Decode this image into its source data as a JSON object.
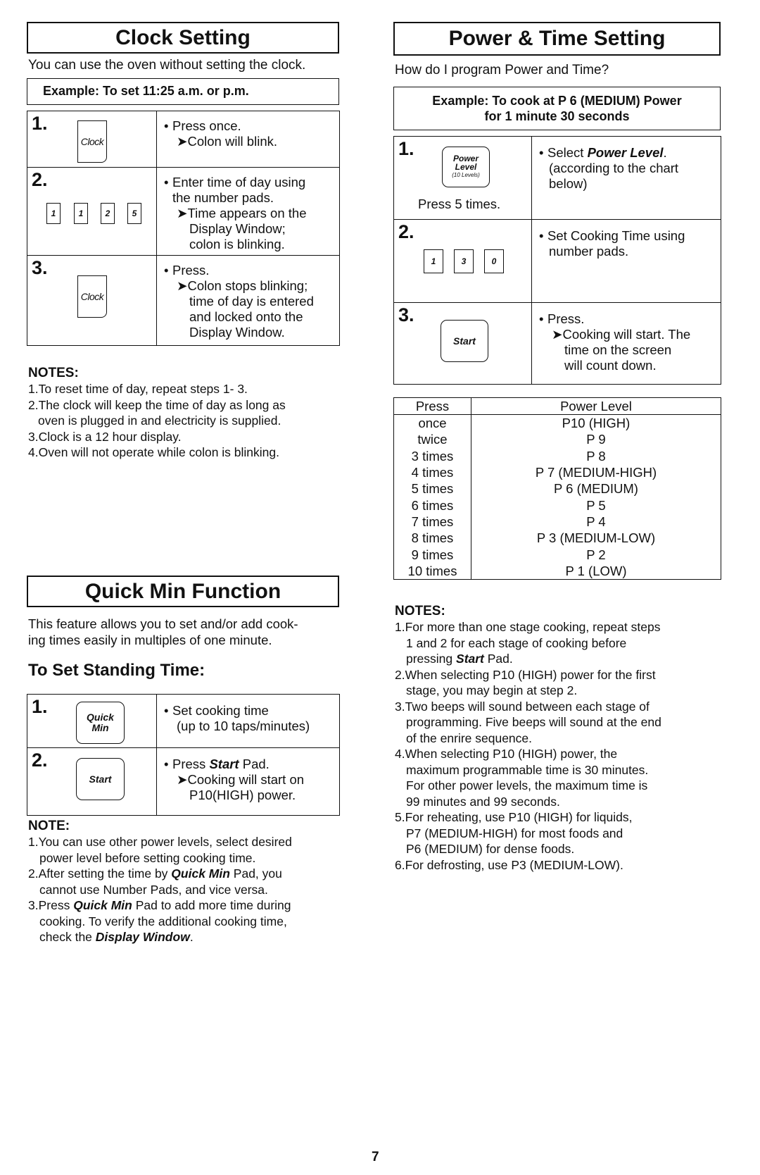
{
  "clock_setting": {
    "title": "Clock Setting",
    "intro": "You can use the oven without setting the clock.",
    "example": "Example:  To set 11:25 a.m. or p.m.",
    "steps": [
      {
        "number": "1.",
        "keys": [
          "Clock"
        ],
        "lines": [
          "Press once.",
          "➤Colon will blink."
        ]
      },
      {
        "number": "2.",
        "keys": [
          "1",
          "1",
          "2",
          "5"
        ],
        "lines": [
          "Enter time of day using",
          "the number pads.",
          "➤Time appears on the",
          "Display Window;",
          "colon is blinking."
        ]
      },
      {
        "number": "3.",
        "keys": [
          "Clock"
        ],
        "lines": [
          "Press.",
          "➤Colon stops blinking;",
          "time of day is entered",
          "and locked onto the",
          "Display Window."
        ]
      }
    ],
    "notes_heading": "NOTES:",
    "notes": [
      [
        "1.To reset time of day, repeat steps 1- 3."
      ],
      [
        "2.The clock will keep the time of day as long as",
        "oven is plugged in and electricity is supplied."
      ],
      [
        "3.Clock is a 12 hour display."
      ],
      [
        "4.Oven will not operate while colon is blinking."
      ]
    ]
  },
  "quick_min": {
    "title": "Quick Min Function",
    "intro": [
      "This feature allows you to set and/or add cook-",
      "ing times easily in multiples of one minute."
    ],
    "subheading": "To Set Standing Time:",
    "steps": [
      {
        "number": "1.",
        "key": [
          "Quick",
          "Min"
        ],
        "lines": [
          "Set cooking time",
          "(up to 10 taps/minutes)"
        ]
      },
      {
        "number": "2.",
        "key": [
          "Start"
        ],
        "lines_pre": "Press ",
        "lines_bold": "Start",
        "lines_post": " Pad.",
        "lines": [
          "➤Cooking will start on",
          "P10(HIGH) power."
        ]
      }
    ],
    "note_heading": "NOTE:",
    "notes": {
      "n1": [
        "1.You can use other power levels, select desired",
        "power level before setting cooking time."
      ],
      "n2_pre": "2.After setting the time by ",
      "n2_bold": "Quick Min",
      "n2_post": " Pad, you",
      "n2_cont": "cannot use Number Pads, and vice versa.",
      "n3_pre": "3.Press ",
      "n3_bold": "Quick Min",
      "n3_post": " Pad to add more time during",
      "n3_cont1": "cooking. To verify the additional cooking time,",
      "n3_cont2_pre": "check the ",
      "n3_cont2_bold": "Display Window",
      "n3_cont2_post": "."
    }
  },
  "power_time": {
    "title": "Power & Time Setting",
    "intro": "How do I program Power and Time?",
    "example": [
      "Example: To cook at P 6 (MEDIUM) Power",
      "for 1 minute 30 seconds"
    ],
    "steps": [
      {
        "number": "1.",
        "key": [
          "Power",
          "Level",
          "(10 Levels)"
        ],
        "caption": "Press 5 times.",
        "line1_pre": "Select ",
        "line1_bold": "Power Level",
        "line1_post": ".",
        "lines": [
          "(according to the chart",
          "below)"
        ]
      },
      {
        "number": "2.",
        "keys": [
          "1",
          "3",
          "0"
        ],
        "lines": [
          "Set Cooking Time using",
          "number pads."
        ]
      },
      {
        "number": "3.",
        "key": [
          "Start"
        ],
        "lines": [
          "Press.",
          "➤Cooking will start. The",
          "time on the screen",
          "will count down."
        ]
      }
    ],
    "power_table": {
      "headers": [
        "Press",
        "Power Level"
      ],
      "rows": [
        [
          "once",
          "P10 (HIGH)"
        ],
        [
          "twice",
          "P 9"
        ],
        [
          "3 times",
          "P 8"
        ],
        [
          "4 times",
          "P 7 (MEDIUM-HIGH)"
        ],
        [
          "5 times",
          "P 6 (MEDIUM)"
        ],
        [
          "6 times",
          "P 5"
        ],
        [
          "7 times",
          "P 4"
        ],
        [
          "8 times",
          "P 3 (MEDIUM-LOW)"
        ],
        [
          "9 times",
          "P 2"
        ],
        [
          "10 times",
          "P 1 (LOW)"
        ]
      ]
    },
    "notes_heading": "NOTES:",
    "notes": {
      "n1_a": "1.For more than one stage cooking, repeat steps",
      "n1_b": "1 and 2 for each stage of cooking before",
      "n1_c_pre": "pressing ",
      "n1_c_bold": "Start",
      "n1_c_post": " Pad.",
      "n2": [
        "2.When selecting P10 (HIGH) power for the first",
        "stage, you may begin at step 2."
      ],
      "n3": [
        "3.Two beeps will sound between each stage of",
        "programming. Five beeps will sound at the end",
        "of the enrire sequence."
      ],
      "n4": [
        "4.When selecting P10 (HIGH) power, the",
        "maximum programmable time is 30 minutes.",
        "For other power levels, the maximum time is",
        "99 minutes and 99 seconds."
      ],
      "n5": [
        "5.For reheating, use P10 (HIGH) for liquids,",
        "P7 (MEDIUM-HIGH) for most foods and",
        "P6 (MEDIUM) for dense foods."
      ],
      "n6": [
        "6.For defrosting, use P3 (MEDIUM-LOW)."
      ]
    }
  },
  "page_number": "7"
}
